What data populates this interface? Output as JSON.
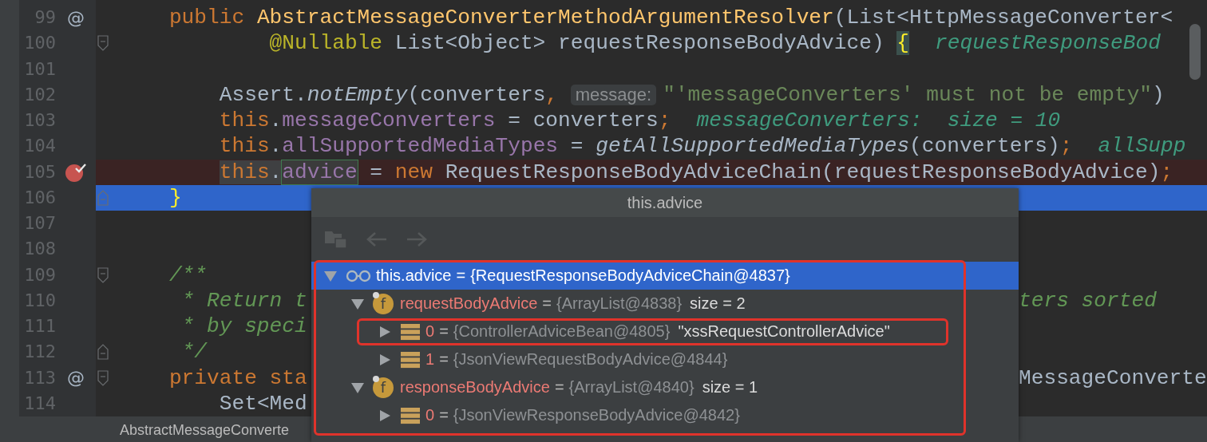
{
  "editor": {
    "lines": [
      {
        "number": "99",
        "marker": {
          "kind": "override",
          "text": "@"
        },
        "segments": [
          {
            "kind": "code",
            "tokens": [
              {
                "kind": "kw",
                "text": "    public "
              },
              {
                "kind": "decl",
                "text": "AbstractMessageConverterMethodArgumentResolver"
              },
              {
                "kind": "plain",
                "text": "(List<HttpMessageConverter<"
              }
            ]
          }
        ]
      },
      {
        "number": "100",
        "fold": {
          "kind": "start"
        },
        "segments": [
          {
            "kind": "code",
            "tokens": [
              {
                "kind": "annot",
                "text": "            @Nullable"
              },
              {
                "kind": "plain",
                "text": " List<Object> requestResponseBodyAdvice) "
              },
              {
                "kind": "brace-match",
                "text": "{"
              }
            ]
          },
          {
            "kind": "inline-value",
            "text": "requestResponseBod"
          }
        ]
      },
      {
        "number": "101"
      },
      {
        "number": "102",
        "segments": [
          {
            "kind": "code",
            "tokens": [
              {
                "kind": "plain",
                "text": "        Assert."
              },
              {
                "kind": "italic",
                "text": "notEmpty"
              },
              {
                "kind": "plain",
                "text": "(converters"
              },
              {
                "kind": "kw",
                "text": ", "
              }
            ]
          },
          {
            "kind": "param-hint",
            "text": "message:"
          },
          {
            "kind": "code",
            "tokens": [
              {
                "kind": "string",
                "text": "\"'messageConverters' must not be empty\""
              },
              {
                "kind": "plain",
                "text": ")"
              }
            ]
          }
        ]
      },
      {
        "number": "103",
        "segments": [
          {
            "kind": "code",
            "tokens": [
              {
                "kind": "kw",
                "text": "        this"
              },
              {
                "kind": "plain",
                "text": "."
              },
              {
                "kind": "field",
                "text": "messageConverters"
              },
              {
                "kind": "plain",
                "text": " = converters"
              },
              {
                "kind": "kw",
                "text": ";"
              }
            ]
          },
          {
            "kind": "inline-value",
            "text": "messageConverters:  size = 10"
          }
        ]
      },
      {
        "number": "104",
        "segments": [
          {
            "kind": "code",
            "tokens": [
              {
                "kind": "kw",
                "text": "        this"
              },
              {
                "kind": "plain",
                "text": "."
              },
              {
                "kind": "field",
                "text": "allSupportedMediaTypes"
              },
              {
                "kind": "plain",
                "text": " = "
              },
              {
                "kind": "italic",
                "text": "getAllSupportedMediaTypes"
              },
              {
                "kind": "plain",
                "text": "(converters)"
              },
              {
                "kind": "kw",
                "text": ";"
              }
            ]
          },
          {
            "kind": "inline-value",
            "text": "allSupp"
          }
        ]
      },
      {
        "number": "105",
        "marker": {
          "kind": "breakpoint"
        },
        "highlight": {
          "kind": "breakpoint"
        },
        "segments": [
          {
            "kind": "code",
            "tokens": [
              {
                "kind": "kw-usage",
                "text": "        this"
              },
              {
                "kind": "plain-usage",
                "text": "."
              },
              {
                "kind": "field-write",
                "text": "advice"
              },
              {
                "kind": "plain",
                "text": " = "
              },
              {
                "kind": "kw",
                "text": "new "
              },
              {
                "kind": "plain",
                "text": "RequestResponseBodyAdviceChain(requestResponseBodyAdvice)"
              },
              {
                "kind": "kw",
                "text": ";"
              }
            ]
          }
        ]
      },
      {
        "number": "106",
        "fold": {
          "kind": "end"
        },
        "highlight": {
          "kind": "execution"
        },
        "segments": [
          {
            "kind": "code",
            "tokens": [
              {
                "kind": "brace",
                "text": "    }"
              }
            ]
          }
        ]
      },
      {
        "number": "107"
      },
      {
        "number": "108"
      },
      {
        "number": "109",
        "fold": {
          "kind": "start"
        },
        "segments": [
          {
            "kind": "code",
            "tokens": [
              {
                "kind": "comment",
                "text": "    /**"
              }
            ]
          }
        ]
      },
      {
        "number": "110",
        "segments": [
          {
            "kind": "code",
            "tokens": [
              {
                "kind": "comment",
                "text": "     * Return t"
              }
            ]
          }
        ],
        "right": [
          {
            "kind": "comment",
            "text": "ters sorted"
          }
        ]
      },
      {
        "number": "111",
        "segments": [
          {
            "kind": "code",
            "tokens": [
              {
                "kind": "comment",
                "text": "     * by speci"
              }
            ]
          }
        ]
      },
      {
        "number": "112",
        "fold": {
          "kind": "end"
        },
        "segments": [
          {
            "kind": "code",
            "tokens": [
              {
                "kind": "comment",
                "text": "     */"
              }
            ]
          }
        ]
      },
      {
        "number": "113",
        "marker": {
          "kind": "override",
          "text": "@"
        },
        "fold": {
          "kind": "start"
        },
        "segments": [
          {
            "kind": "code",
            "tokens": [
              {
                "kind": "kw",
                "text": "    private sta"
              }
            ]
          }
        ],
        "right": [
          {
            "kind": "plain",
            "text": "MessageConverte"
          }
        ]
      },
      {
        "number": "114",
        "segments": [
          {
            "kind": "code",
            "tokens": [
              {
                "kind": "plain",
                "text": "        Set<Med"
              }
            ]
          }
        ]
      }
    ],
    "breadcrumb": "AbstractMessageConverte"
  },
  "popup": {
    "title": "this.advice",
    "toolbar": [
      {
        "kind": "layout",
        "disabled": true
      },
      {
        "kind": "back",
        "disabled": true
      },
      {
        "kind": "forward",
        "disabled": true
      }
    ],
    "tree": {
      "framed": true,
      "nodes": [
        {
          "kind": "watch",
          "name": "this.advice",
          "op": "=",
          "value": "{RequestResponseBodyAdviceChain@4837}",
          "expanded": true,
          "selected": true,
          "framed": false,
          "children": [
            {
              "kind": "field",
              "badge": "f",
              "name": "requestBodyAdvice",
              "op": "=",
              "value": "{ArrayList@4838}",
              "extra": "size = 2",
              "expanded": true,
              "selected": false,
              "framed": false,
              "children": [
                {
                  "kind": "element",
                  "name": "0",
                  "op": "=",
                  "value": "{ControllerAdviceBean@4805}",
                  "extra": "\"xssRequestControllerAdvice\"",
                  "expanded": false,
                  "selected": false,
                  "framed": true
                },
                {
                  "kind": "element",
                  "name": "1",
                  "op": "=",
                  "value": "{JsonViewRequestBodyAdvice@4844}",
                  "expanded": false,
                  "selected": false,
                  "framed": false
                }
              ]
            },
            {
              "kind": "field",
              "badge": "f",
              "name": "responseBodyAdvice",
              "op": "=",
              "value": "{ArrayList@4840}",
              "extra": "size = 1",
              "expanded": true,
              "selected": false,
              "framed": false,
              "children": [
                {
                  "kind": "element",
                  "name": "0",
                  "op": "=",
                  "value": "{JsonViewResponseBodyAdvice@4842}",
                  "expanded": false,
                  "selected": false,
                  "framed": false
                }
              ]
            }
          ]
        }
      ]
    }
  }
}
